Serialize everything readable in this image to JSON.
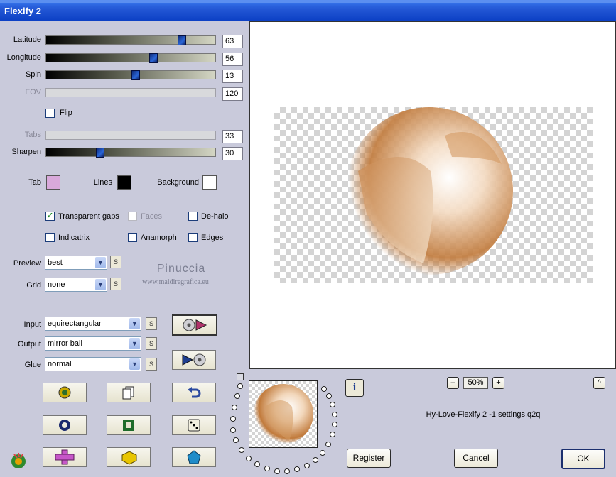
{
  "window": {
    "title": "Flexify 2"
  },
  "colors": {
    "tab": "#d9a9db",
    "lines": "#000000",
    "background": "#ffffff"
  },
  "sliders": [
    {
      "label": "Latitude",
      "value": "63",
      "fraction": 0.82,
      "enabled": true
    },
    {
      "label": "Longitude",
      "value": "56",
      "fraction": 0.64,
      "enabled": true
    },
    {
      "label": "Spin",
      "value": "13",
      "fraction": 0.53,
      "enabled": true
    },
    {
      "label": "FOV",
      "value": "120",
      "fraction": 0,
      "enabled": false
    },
    {
      "label": "Tabs",
      "value": "33",
      "fraction": 0,
      "enabled": false
    },
    {
      "label": "Sharpen",
      "value": "30",
      "fraction": 0.31,
      "enabled": true
    }
  ],
  "flip": {
    "label": "Flip",
    "checked": false
  },
  "color_labels": {
    "tab": "Tab",
    "lines": "Lines",
    "background": "Background"
  },
  "checkboxes": {
    "transparent_gaps": {
      "label": "Transparent gaps",
      "checked": true
    },
    "faces": {
      "label": "Faces",
      "checked": false
    },
    "de_halo": {
      "label": "De-halo",
      "checked": false
    },
    "indicatrix": {
      "label": "Indicatrix",
      "checked": false
    },
    "anamorph": {
      "label": "Anamorph",
      "checked": false
    },
    "edges": {
      "label": "Edges",
      "checked": false
    }
  },
  "preview_select": {
    "label": "Preview",
    "value": "best"
  },
  "grid_select": {
    "label": "Grid",
    "value": "none"
  },
  "input_select": {
    "label": "Input",
    "value": "equirectangular"
  },
  "output_select": {
    "label": "Output",
    "value": "mirror ball"
  },
  "glue_select": {
    "label": "Glue",
    "value": "normal"
  },
  "s_label": "S",
  "watermark": {
    "name": "Pinuccia",
    "url": "www.maidiregrafica.eu"
  },
  "zoom": {
    "minus": "–",
    "value": "50%",
    "plus": "+",
    "up": "^"
  },
  "info_icon": "i",
  "settings_file": "Hy-Love-Flexify 2 -1 settings.q2q",
  "buttons": {
    "register": "Register",
    "cancel": "Cancel",
    "ok": "OK"
  },
  "icons": [
    "play-forward-icon",
    "play-back-icon",
    "randomize-icon",
    "copy-icon",
    "undo-icon",
    "ring-icon",
    "square-icon",
    "dice-icon",
    "plus-shape-icon",
    "brick-icon",
    "pentagon-icon",
    "logo-icon"
  ]
}
